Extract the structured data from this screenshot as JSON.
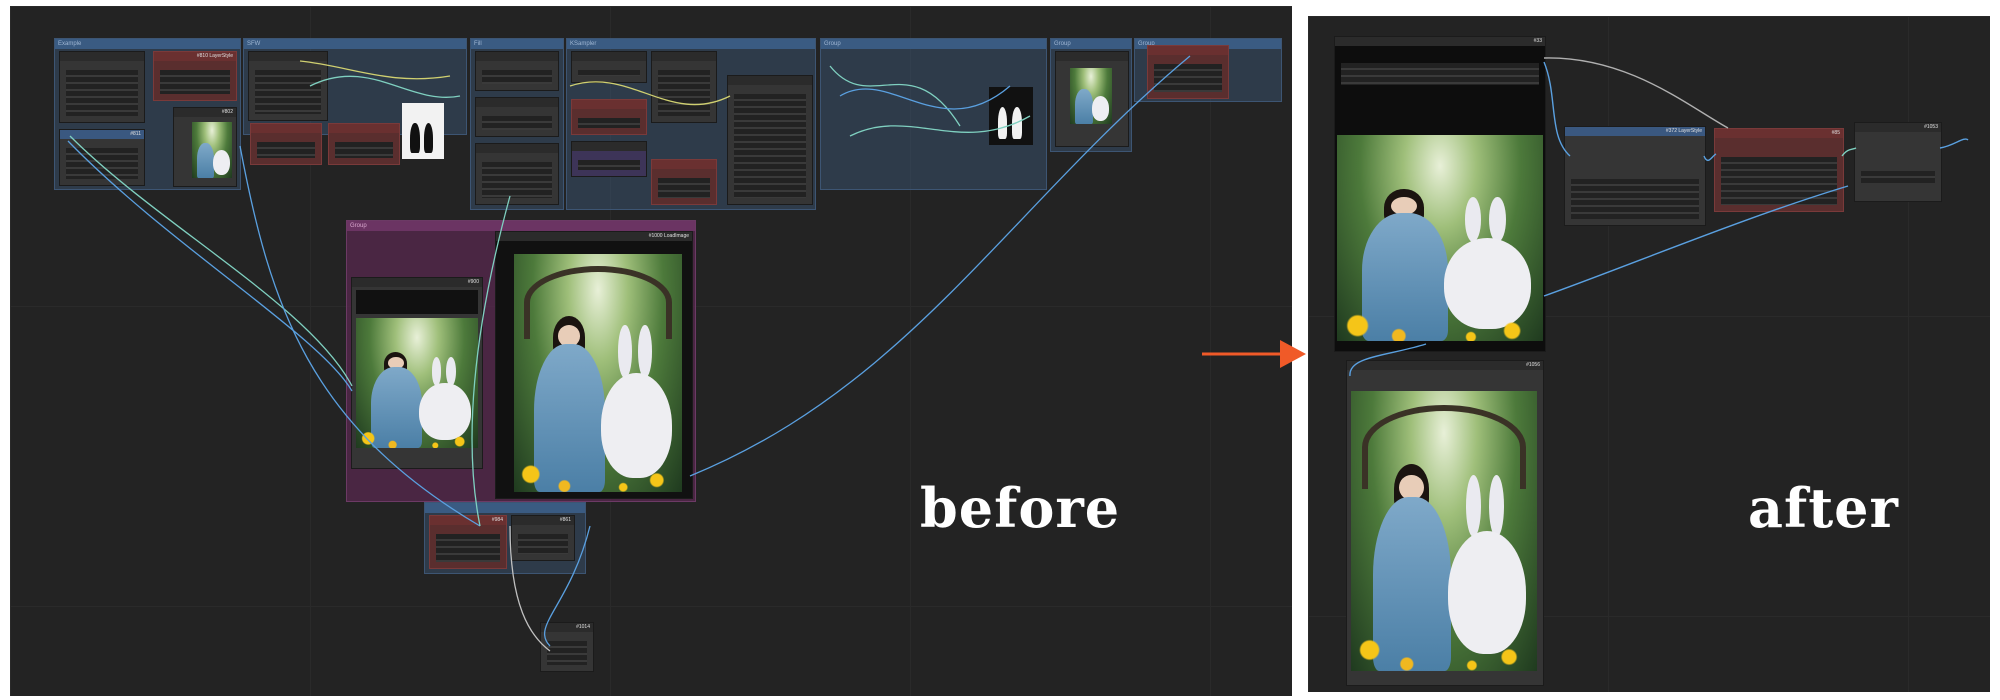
{
  "before": {
    "label": "before",
    "groups": [
      {
        "title": "Example"
      },
      {
        "title": "SFW"
      },
      {
        "title": "Fill"
      },
      {
        "title": "KSampler"
      },
      {
        "title": "Group"
      },
      {
        "title": "Group"
      },
      {
        "title": "Group"
      },
      {
        "title": "Group"
      }
    ],
    "nodes": [
      "#810 LayerStyle",
      "#811",
      "#802",
      "#900",
      "#1000 LoadImage",
      "#984",
      "#861",
      "#1014"
    ]
  },
  "after": {
    "label": "after",
    "nodes": [
      "#33",
      "#1056",
      "#372 LayerStyle",
      "#85",
      "#1053"
    ]
  },
  "arrow_color": "#f05a28",
  "accent_colors": {
    "group_blue": "#3a5b82",
    "group_purple": "#6b3463",
    "wire_blue": "#5aa0e0",
    "node_red": "#5a2e2e"
  }
}
